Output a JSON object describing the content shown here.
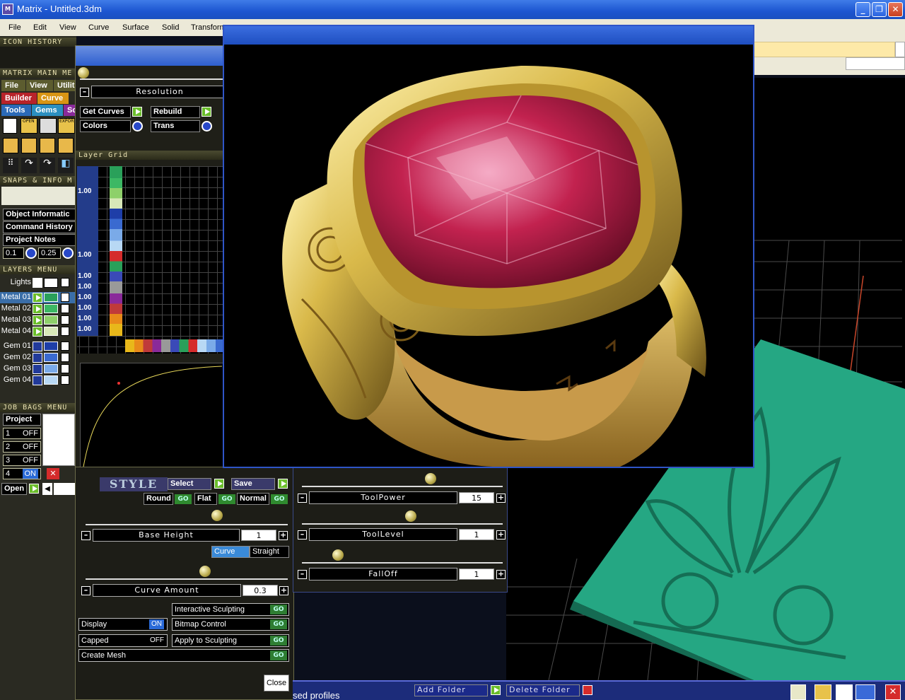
{
  "window": {
    "title": "Matrix - Untitled.3dm",
    "minimize": "_",
    "restore": "❐",
    "close": "✕"
  },
  "menu": [
    "File",
    "Edit",
    "View",
    "Curve",
    "Surface",
    "Solid",
    "Transform"
  ],
  "left": {
    "icon_history": "ICON HISTORY",
    "main_menu": "MATRIX MAIN ME",
    "tabs_row1": [
      "File",
      "View",
      "Utilit"
    ],
    "tabs_row2": [
      "Builder",
      "Curve"
    ],
    "tabs_row3": [
      "Tools",
      "Gems",
      "Sc"
    ],
    "icon_labels": [
      "OPEN",
      "EXPOR"
    ],
    "snaps": "SNAPS & INFO M",
    "info_items": [
      "Object Informatic",
      "Command History",
      "Project Notes"
    ],
    "values": [
      "0.1",
      "0.25"
    ],
    "layers_menu": "LAYERS MENU",
    "lights": "Lights",
    "metals": [
      "Metal 01",
      "Metal 02",
      "Metal 03",
      "Metal 04"
    ],
    "gems": [
      "Gem 01",
      "Gem 02",
      "Gem 03",
      "Gem 04"
    ],
    "job_bags": "JOB BAGS MENU",
    "project": "Project",
    "jobs": [
      {
        "n": "1",
        "s": "OFF"
      },
      {
        "n": "2",
        "s": "OFF"
      },
      {
        "n": "3",
        "s": "OFF"
      },
      {
        "n": "4",
        "s": "ON"
      }
    ],
    "open": "Open"
  },
  "resolution_panel": {
    "resolution": "Resolution",
    "get_curves": "Get Curves",
    "rebuild": "Rebuild",
    "colors": "Colors",
    "trans": "Trans",
    "layer_grid": "Layer Grid",
    "grid_values": [
      "1.00",
      "1.00",
      "1.00",
      "1.00",
      "1.00",
      "1.00",
      "1.00",
      "1.00"
    ]
  },
  "style_panel": {
    "style": "STYLE",
    "select": "Select",
    "save": "Save",
    "round": "Round",
    "flat": "Flat",
    "normal": "Normal",
    "go": "GO",
    "base_height": {
      "label": "Base Height",
      "value": "1"
    },
    "curve": "Curve",
    "straight": "Straight",
    "curve_amount": {
      "label": "Curve Amount",
      "value": "0.3"
    },
    "interactive": "Interactive Sculpting",
    "display": "Display",
    "display_state": "ON",
    "bitmap": "Bitmap Control",
    "capped": "Capped",
    "capped_state": "OFF",
    "apply": "Apply to Sculpting",
    "create_mesh": "Create Mesh",
    "close": "Close"
  },
  "tool_panel": {
    "tool_power": {
      "label": "ToolPower",
      "value": "15"
    },
    "tool_level": {
      "label": "ToolLevel",
      "value": "1"
    },
    "falloff": {
      "label": "FallOff",
      "value": "1"
    }
  },
  "bottom": {
    "used_profiles": "sed profiles",
    "add_folder": "Add Folder",
    "delete_folder": "Delete Folder"
  },
  "colors": {
    "title_blue": "#2456d4",
    "panel_bg": "#1a1a1a",
    "render_bg": "#000000",
    "gold": "#d9b94a",
    "ruby": "#c2224f",
    "relief": "#2fb08a"
  }
}
